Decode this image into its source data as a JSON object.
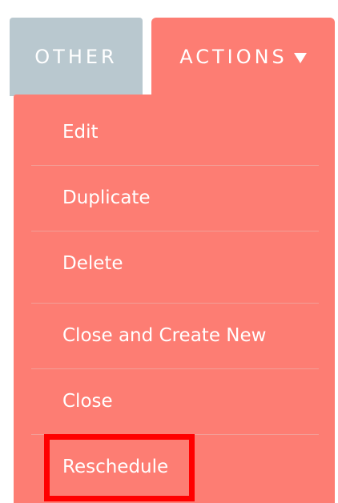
{
  "tabs": {
    "other": "OTHER",
    "actions": "ACTIONS"
  },
  "menu": {
    "items": [
      {
        "label": "Edit"
      },
      {
        "label": "Duplicate"
      },
      {
        "label": "Delete"
      },
      {
        "label": "Close and Create New"
      },
      {
        "label": "Close"
      },
      {
        "label": "Reschedule"
      }
    ]
  },
  "icons": {
    "actions_caret": "caret-down-icon"
  },
  "colors": {
    "actions_tab": "#fd7d73",
    "other_tab": "#b9c8cf",
    "highlight_box": "#ff0000",
    "text": "#ffffff"
  }
}
